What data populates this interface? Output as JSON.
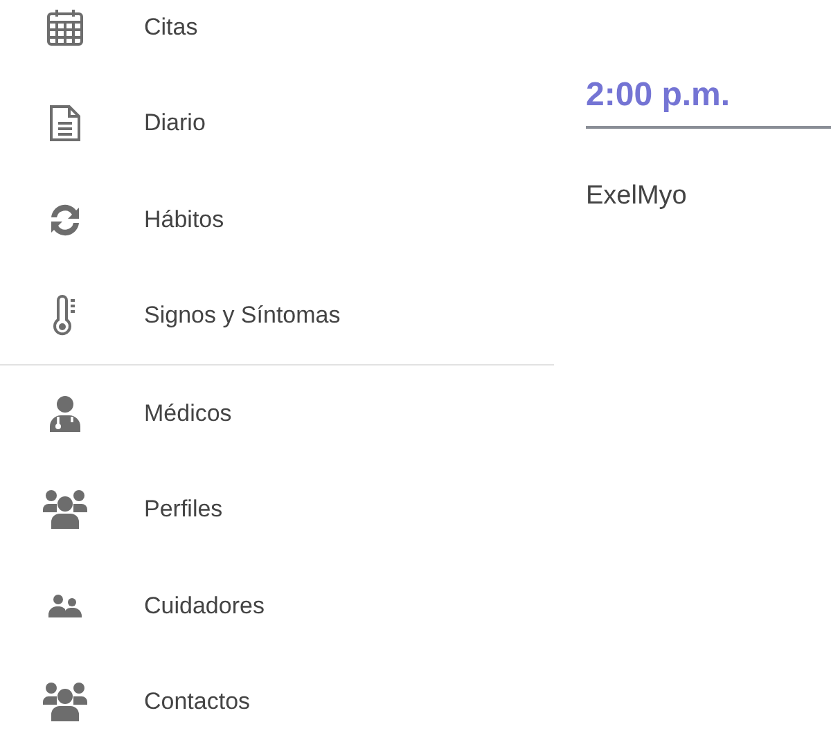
{
  "menu": {
    "sections": [
      {
        "items": [
          {
            "kind": "calendar",
            "label": "Citas"
          },
          {
            "kind": "document",
            "label": "Diario"
          },
          {
            "kind": "refresh",
            "label": "Hábitos"
          },
          {
            "kind": "thermometer",
            "label": "Signos y Síntomas"
          }
        ]
      },
      {
        "items": [
          {
            "kind": "doctor",
            "label": "Médicos"
          },
          {
            "kind": "group",
            "label": "Perfiles"
          },
          {
            "kind": "pair",
            "label": "Cuidadores"
          },
          {
            "kind": "group",
            "label": "Contactos"
          }
        ]
      }
    ]
  },
  "detail": {
    "time": "2:00 p.m.",
    "name": "ExelMyo"
  }
}
